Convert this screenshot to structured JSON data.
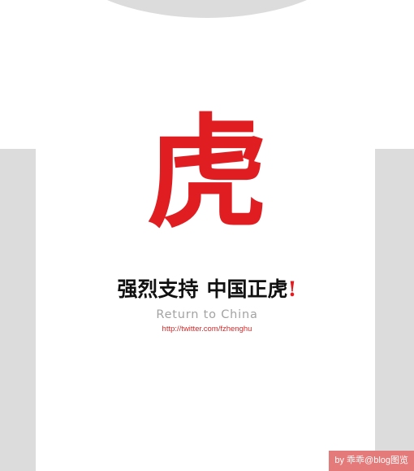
{
  "design": {
    "big_glyph": "虎",
    "slogan_part1": "强烈支持",
    "slogan_part2": "中国正虎",
    "slogan_exclaim": "!",
    "subtitle": "Return to China",
    "url": "http://twitter.com/fzhenghu"
  },
  "watermark": {
    "text": "by 乖乖@blog图览"
  },
  "colors": {
    "shirt": "#ffffff",
    "background": "#dcdcdc",
    "accent_red": "#e01e22",
    "slogan_black": "#111111",
    "subtitle_gray": "#a3a3a3",
    "watermark_bg": "#e57a7a"
  }
}
